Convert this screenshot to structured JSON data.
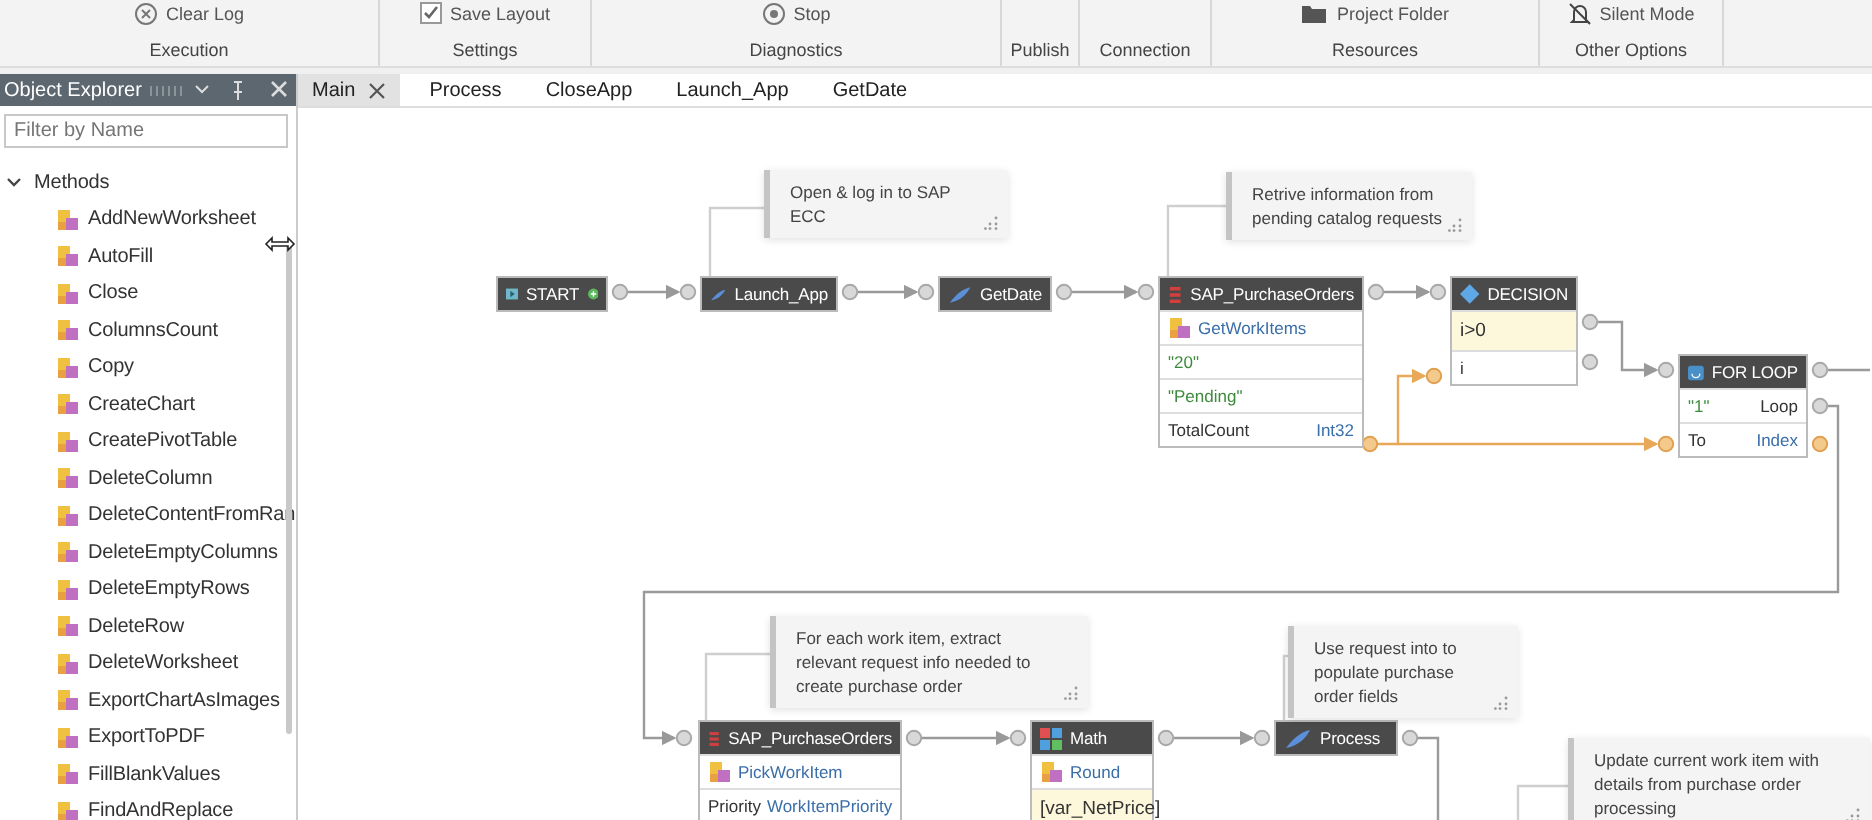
{
  "ribbon": {
    "groups": [
      {
        "label": "Execution",
        "buttons": [
          {
            "label": "Clear Log",
            "kind": "clear"
          }
        ]
      },
      {
        "label": "Settings",
        "buttons": [
          {
            "label": "Save Layout",
            "kind": "checkbox",
            "checked": true
          }
        ]
      },
      {
        "label": "Diagnostics",
        "buttons": [
          {
            "label": "Stop",
            "kind": "stop"
          }
        ]
      },
      {
        "label": "Publish"
      },
      {
        "label": "Connection"
      },
      {
        "label": "Resources",
        "buttons": [
          {
            "label": "Project Folder",
            "kind": "folder"
          }
        ]
      },
      {
        "label": "Other Options",
        "buttons": [
          {
            "label": "Silent Mode",
            "kind": "bell"
          }
        ]
      }
    ]
  },
  "object_explorer": {
    "title": "Object Explorer",
    "filter": {
      "placeholder": "Filter by Name"
    },
    "tree": [
      {
        "label": "Methods",
        "expanded": true,
        "children": [
          {
            "label": "AddNewWorksheet"
          },
          {
            "label": "AutoFill"
          },
          {
            "label": "Close"
          },
          {
            "label": "ColumnsCount"
          },
          {
            "label": "Copy"
          },
          {
            "label": "CreateChart"
          },
          {
            "label": "CreatePivotTable"
          },
          {
            "label": "DeleteColumn"
          },
          {
            "label": "DeleteContentFromRan"
          },
          {
            "label": "DeleteEmptyColumns"
          },
          {
            "label": "DeleteEmptyRows"
          },
          {
            "label": "DeleteRow"
          },
          {
            "label": "DeleteWorksheet"
          },
          {
            "label": "ExportChartAsImages"
          },
          {
            "label": "ExportToPDF"
          },
          {
            "label": "FillBlankValues"
          },
          {
            "label": "FindAndReplace"
          }
        ]
      }
    ]
  },
  "tabs": [
    {
      "label": "Main",
      "selected": true,
      "closable": true
    },
    {
      "label": "Process",
      "selected": false,
      "closable": false
    },
    {
      "label": "CloseApp",
      "selected": false,
      "closable": false
    },
    {
      "label": "Launch_App",
      "selected": false,
      "closable": false
    },
    {
      "label": "GetDate",
      "selected": false,
      "closable": false
    }
  ],
  "canvas": {
    "nodes": [
      {
        "kind": "start",
        "title": "START"
      },
      {
        "kind": "flow",
        "title": "Launch_App"
      },
      {
        "kind": "flow",
        "title": "GetDate"
      },
      {
        "kind": "sap",
        "title": "SAP_PurchaseOrders",
        "rows": [
          {
            "kind": "method",
            "cells": [
              "GetWorkItems"
            ]
          },
          {
            "kind": "value",
            "cells": [
              "\"20\""
            ]
          },
          {
            "kind": "value",
            "cells": [
              "\"Pending\""
            ]
          },
          {
            "kind": "param",
            "cells": [
              "TotalCount",
              "Int32"
            ]
          }
        ]
      },
      {
        "kind": "decision",
        "title": "DECISION",
        "rows": [
          {
            "kind": "condition",
            "cells": [
              "i>0"
            ]
          },
          {
            "kind": "param",
            "cells": [
              "i"
            ]
          }
        ]
      },
      {
        "kind": "loop",
        "title": "FOR LOOP",
        "rows": [
          {
            "kind": "value",
            "cells": [
              "\"1\"",
              "Loop"
            ]
          },
          {
            "kind": "param",
            "cells": [
              "To",
              "Index"
            ]
          }
        ]
      },
      {
        "kind": "sap",
        "title": "SAP_PurchaseOrders",
        "rows": [
          {
            "kind": "method",
            "cells": [
              "PickWorkItem"
            ]
          },
          {
            "kind": "param",
            "cells": [
              "Priority",
              "WorkItemPriority"
            ]
          }
        ]
      },
      {
        "kind": "math",
        "title": "Math",
        "rows": [
          {
            "kind": "method",
            "cells": [
              "Round"
            ]
          },
          {
            "kind": "condition",
            "cells": [
              "[var_NetPrice]"
            ]
          }
        ]
      },
      {
        "kind": "flow",
        "title": "Process"
      }
    ],
    "notes": [
      {
        "text": "Open & log in to SAP ECC"
      },
      {
        "text": "Retrive information from pending catalog requests"
      },
      {
        "text": "For each work item, extract relevant request info needed to create purchase order"
      },
      {
        "text": "Use request into to populate purchase order fields"
      },
      {
        "text": "Update current work item with details from purchase order processing"
      }
    ]
  }
}
